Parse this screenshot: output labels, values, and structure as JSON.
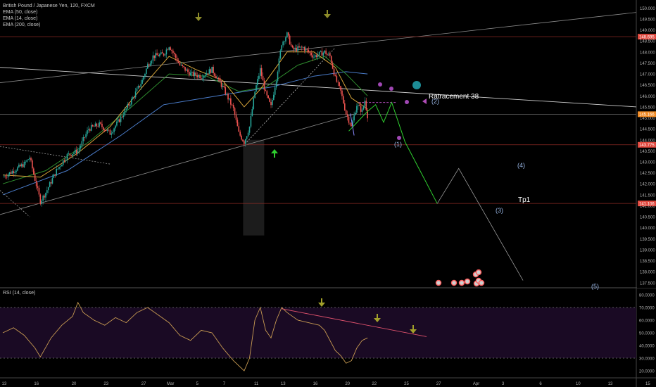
{
  "legend": {
    "symbol": "British Pound / Japanese Yen, 120, FXCM",
    "ema50": "EMA (50, close)",
    "ema14": "EMA (14, close)",
    "ema200": "EMA (200, close)"
  },
  "rsi_legend": "RSI (14, close)",
  "annotations": {
    "retracement": "Ratracement 38",
    "tp": "Tp1",
    "wave1": "(1)",
    "wave2": "(2)",
    "wave3": "(3)",
    "wave4": "(4)",
    "wave5": "(5)"
  },
  "chart_data": {
    "type": "candlestick",
    "price_axis": {
      "ticks": [
        "150.000",
        "149.500",
        "149.000",
        "148.500",
        "148.000",
        "147.500",
        "147.000",
        "146.500",
        "146.000",
        "145.500",
        "145.000",
        "144.500",
        "144.000",
        "143.500",
        "143.000",
        "142.500",
        "142.000",
        "141.500",
        "141.000",
        "140.500",
        "140.000",
        "139.500",
        "139.000",
        "138.500",
        "138.000",
        "137.500"
      ],
      "range": [
        137.3,
        150.3
      ]
    },
    "price_badges": [
      {
        "value": 148.695,
        "label": "148.695",
        "color": "#e0483e"
      },
      {
        "value": 145.166,
        "label": "145.166",
        "color": "#f08a24"
      },
      {
        "value": 143.775,
        "label": "143.775",
        "color": "#e0483e"
      },
      {
        "value": 141.106,
        "label": "141.106",
        "color": "#e0483e"
      }
    ],
    "rsi_axis": {
      "ticks": [
        "80.0000",
        "70.0000",
        "60.0000",
        "50.0000",
        "40.0000",
        "30.0000",
        "20.0000"
      ],
      "range": [
        15,
        85
      ],
      "bands": [
        70,
        30
      ]
    },
    "x_axis": {
      "ticks": [
        "13",
        "16",
        "20",
        "23",
        "27",
        "Mar",
        "5",
        "7",
        "11",
        "13",
        "16",
        "20",
        "22",
        "25",
        "27",
        "Apr",
        "3",
        "6",
        "10",
        "13",
        "15"
      ],
      "positions": [
        0,
        6,
        13,
        19,
        26,
        31,
        36,
        41,
        47,
        52,
        58,
        64,
        69,
        75,
        81,
        88,
        93,
        100,
        107,
        113,
        120
      ]
    },
    "price_path": [
      [
        0,
        142.3
      ],
      [
        2,
        142.6
      ],
      [
        4,
        142.9
      ],
      [
        5,
        143.2
      ],
      [
        6,
        142.2
      ],
      [
        7,
        141.2
      ],
      [
        8,
        141.6
      ],
      [
        10,
        142.6
      ],
      [
        12,
        143.3
      ],
      [
        14,
        143.5
      ],
      [
        16,
        144.5
      ],
      [
        18,
        144.7
      ],
      [
        20,
        144.3
      ],
      [
        22,
        145.0
      ],
      [
        24,
        145.8
      ],
      [
        26,
        146.7
      ],
      [
        27,
        147.4
      ],
      [
        28,
        147.8
      ],
      [
        30,
        147.9
      ],
      [
        31,
        148.3
      ],
      [
        33,
        147.4
      ],
      [
        35,
        147.0
      ],
      [
        37,
        146.9
      ],
      [
        39,
        147.2
      ],
      [
        41,
        146.4
      ],
      [
        43,
        145.4
      ],
      [
        44,
        144.3
      ],
      [
        45,
        143.9
      ],
      [
        46,
        144.6
      ],
      [
        47,
        146.2
      ],
      [
        48,
        147.2
      ],
      [
        49,
        146.1
      ],
      [
        50,
        145.5
      ],
      [
        51,
        146.8
      ],
      [
        52,
        148.4
      ],
      [
        53,
        148.8
      ],
      [
        54,
        148.1
      ],
      [
        56,
        148.2
      ],
      [
        58,
        147.8
      ],
      [
        60,
        148.0
      ],
      [
        61,
        147.8
      ],
      [
        62,
        146.8
      ],
      [
        63,
        146.2
      ],
      [
        64,
        145.2
      ],
      [
        65,
        144.6
      ],
      [
        66,
        145.6
      ],
      [
        67,
        145.3
      ],
      [
        67.5,
        145.8
      ],
      [
        68,
        145.1
      ]
    ],
    "ema14": [
      [
        0,
        142.4
      ],
      [
        7,
        142.3
      ],
      [
        14,
        143.4
      ],
      [
        20,
        144.6
      ],
      [
        26,
        146.4
      ],
      [
        31,
        147.8
      ],
      [
        36,
        147.2
      ],
      [
        41,
        146.7
      ],
      [
        45,
        145.5
      ],
      [
        48,
        146.3
      ],
      [
        53,
        148.0
      ],
      [
        58,
        148.0
      ],
      [
        62,
        147.3
      ],
      [
        65,
        145.9
      ],
      [
        68,
        145.4
      ]
    ],
    "ema50": [
      [
        0,
        142.0
      ],
      [
        8,
        142.6
      ],
      [
        16,
        143.9
      ],
      [
        24,
        145.5
      ],
      [
        31,
        147.0
      ],
      [
        38,
        146.9
      ],
      [
        44,
        146.2
      ],
      [
        49,
        146.4
      ],
      [
        55,
        147.4
      ],
      [
        60,
        147.8
      ],
      [
        64,
        147.0
      ],
      [
        68,
        146.0
      ]
    ],
    "ema200": [
      [
        0,
        141.5
      ],
      [
        12,
        142.6
      ],
      [
        22,
        144.2
      ],
      [
        30,
        145.6
      ],
      [
        40,
        146.0
      ],
      [
        50,
        146.4
      ],
      [
        58,
        146.9
      ],
      [
        64,
        147.1
      ],
      [
        68,
        147.0
      ]
    ],
    "rsi": [
      [
        0,
        50
      ],
      [
        2,
        54
      ],
      [
        4,
        48
      ],
      [
        6,
        38
      ],
      [
        7,
        31
      ],
      [
        9,
        46
      ],
      [
        11,
        56
      ],
      [
        13,
        63
      ],
      [
        14,
        74
      ],
      [
        15,
        66
      ],
      [
        17,
        60
      ],
      [
        19,
        56
      ],
      [
        21,
        62
      ],
      [
        23,
        58
      ],
      [
        25,
        66
      ],
      [
        27,
        70
      ],
      [
        29,
        64
      ],
      [
        31,
        58
      ],
      [
        33,
        48
      ],
      [
        35,
        44
      ],
      [
        37,
        52
      ],
      [
        39,
        50
      ],
      [
        41,
        38
      ],
      [
        43,
        28
      ],
      [
        45,
        20
      ],
      [
        46,
        30
      ],
      [
        47,
        60
      ],
      [
        48,
        70
      ],
      [
        49,
        52
      ],
      [
        50,
        46
      ],
      [
        51,
        60
      ],
      [
        52,
        70
      ],
      [
        53,
        66
      ],
      [
        55,
        60
      ],
      [
        57,
        58
      ],
      [
        59,
        56
      ],
      [
        60,
        52
      ],
      [
        62,
        36
      ],
      [
        63,
        32
      ],
      [
        64,
        26
      ],
      [
        65,
        28
      ],
      [
        66,
        38
      ],
      [
        67,
        44
      ],
      [
        68,
        46
      ]
    ],
    "projection": [
      [
        64.5,
        144.4
      ],
      [
        68,
        145.3
      ],
      [
        69.5,
        145.6
      ],
      [
        71,
        144.8
      ],
      [
        72.5,
        145.7
      ],
      [
        75,
        143.9
      ],
      [
        81,
        141.1
      ],
      [
        85,
        142.7
      ],
      [
        97,
        137.6
      ]
    ]
  }
}
